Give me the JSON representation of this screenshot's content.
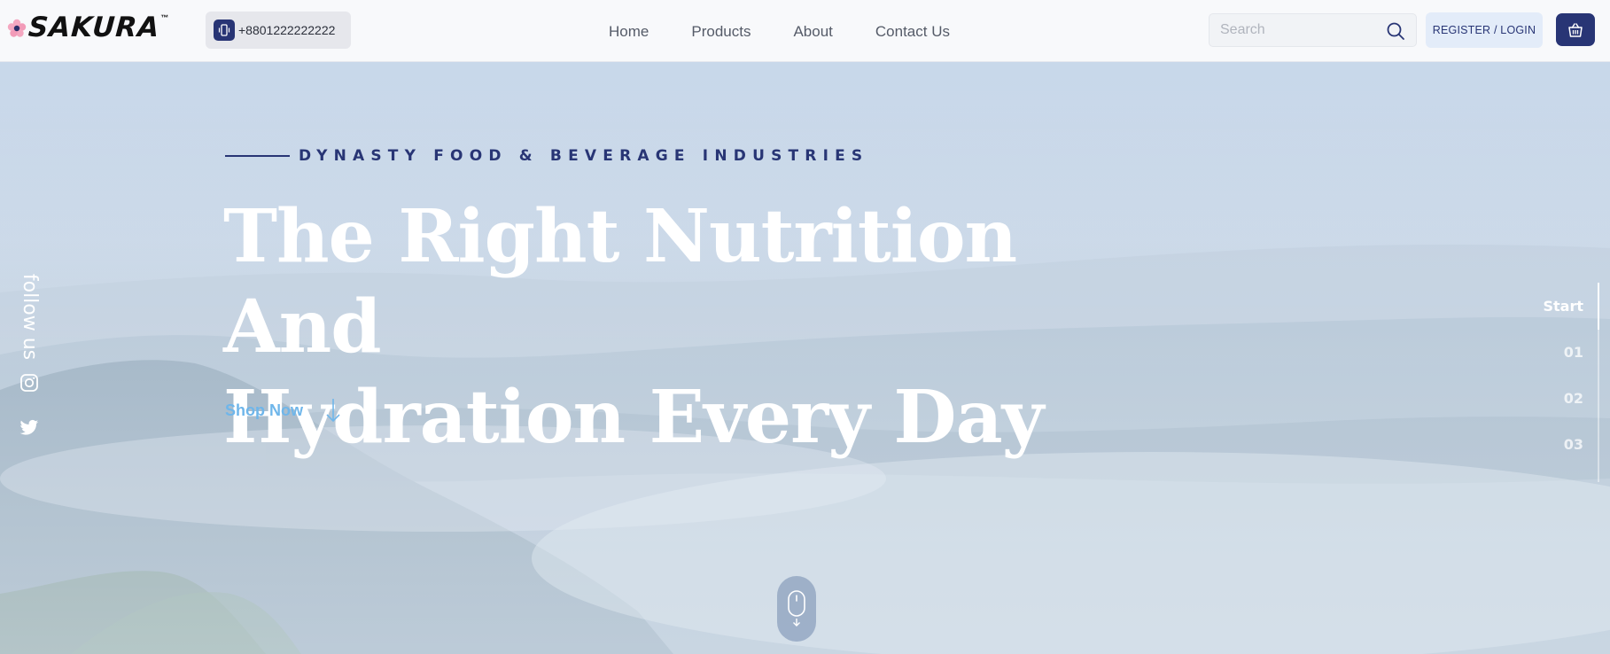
{
  "header": {
    "logo_text": "SAKURA",
    "logo_tm": "™",
    "phone": "+8801222222222",
    "nav": [
      "Home",
      "Products",
      "About",
      "Contact Us"
    ],
    "search_placeholder": "Search",
    "register_label": "REGISTER / LOGIN"
  },
  "hero": {
    "eyebrow": "DYNASTY FOOD & BEVERAGE INDUSTRIES",
    "headline_line1": "The Right Nutrition And",
    "headline_line2": "Hydration Every Day",
    "cta_label": "Shop Now",
    "follow_label": "follow us",
    "slides": [
      "Start",
      "01",
      "02",
      "03"
    ],
    "active_slide": "Start"
  },
  "icons": {
    "phone": "phone-icon",
    "search": "search-icon",
    "cart": "basket-icon",
    "instagram": "instagram-icon",
    "twitter": "twitter-icon",
    "scroll": "mouse-scroll-icon",
    "arrow": "arrow-down-icon"
  },
  "colors": {
    "brand_navy": "#283575",
    "cta_blue": "#6fb6ea",
    "header_bg": "#f8f9fb"
  }
}
